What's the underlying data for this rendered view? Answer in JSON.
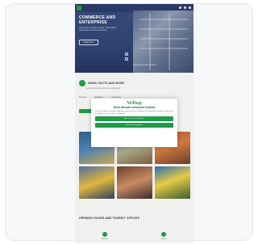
{
  "hero": {
    "title": "COMMERCE AND ENTERPRISE",
    "subtitle": "Lorem ipsum dolor sit amet, consectetur adipiscing elit sed do eiusmod",
    "button_label": "Read more",
    "caption": "Lorem ipsum dolor sit amet"
  },
  "page": {
    "search_title": "NEWS, FACTS AND MORE",
    "search_subtitle": "Lorem ipsum dolor sit amet consectetur",
    "tabs": [
      "Business",
      "Education",
      "Community"
    ],
    "section_title": "OPENING HOURS AND TOURIST OFFICES",
    "bottom_labels": [
      "Address",
      "Contact"
    ]
  },
  "consent": {
    "logo": "Veltop",
    "title": "Diese Website verwendet Cookies",
    "body": "Wir nutzen Cookies, um Inhalte und Anzeigen zu personalisieren, Funktionen für soziale Medien anbieten zu können und die Zugriffe auf unsere Website zu analysieren.",
    "accept_all_label": "Alle Cookies akzeptieren",
    "accept_selected_label": "Auswahl akzeptieren"
  },
  "colors": {
    "brand_green": "#1f9b4a",
    "hero_blue": "#2f4270"
  },
  "icons": [
    "search-icon",
    "menu-icon",
    "user-icon",
    "location-icon",
    "phone-icon"
  ]
}
